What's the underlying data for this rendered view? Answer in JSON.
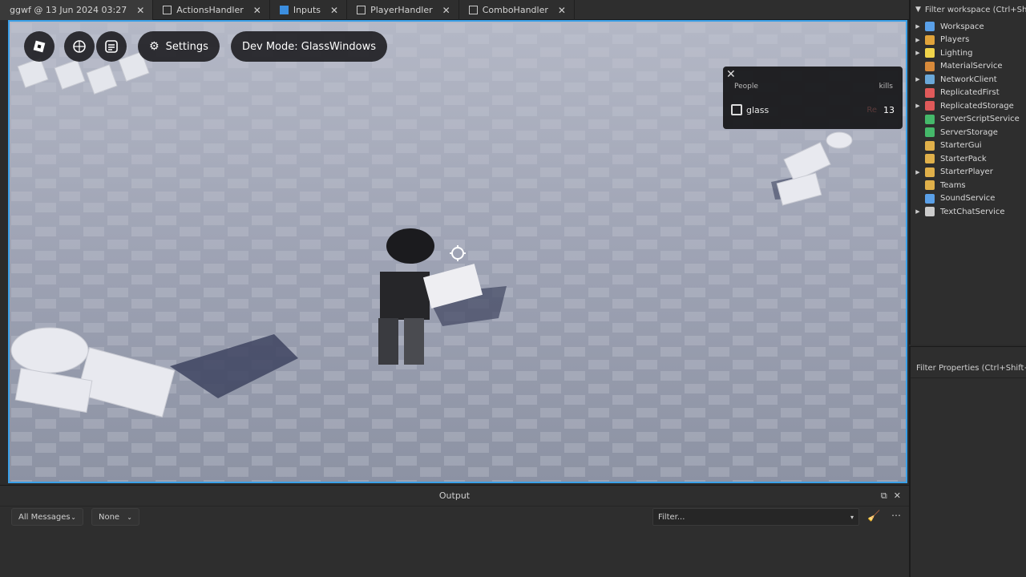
{
  "tabs": [
    {
      "label": "ggwf @ 13 Jun 2024 03:27",
      "icon": "place-icon",
      "color": ""
    },
    {
      "label": "ActionsHandler",
      "icon": "script-icon",
      "color": "#c9c9c9"
    },
    {
      "label": "Inputs",
      "icon": "module-script-icon",
      "color": "#3b8ee0"
    },
    {
      "label": "PlayerHandler",
      "icon": "script-icon",
      "color": "#c9c9c9"
    },
    {
      "label": "ComboHandler",
      "icon": "script-icon",
      "color": "#c9c9c9"
    }
  ],
  "game_ui": {
    "settings_label": "Settings",
    "dev_mode_label": "Dev Mode: GlassWindows",
    "leaderboard": {
      "col_people": "People",
      "col_kills": "kills",
      "rows": [
        {
          "name": "glass",
          "ghost": "Re",
          "kills": "13"
        }
      ]
    }
  },
  "explorer": {
    "filter_placeholder": "Filter workspace (Ctrl+Shift+X)",
    "items": [
      {
        "label": "Workspace",
        "expandable": true,
        "color": "#5aa0e8"
      },
      {
        "label": "Players",
        "expandable": true,
        "color": "#e0a33a"
      },
      {
        "label": "Lighting",
        "expandable": true,
        "color": "#f0d34a"
      },
      {
        "label": "MaterialService",
        "expandable": false,
        "color": "#d88a3a"
      },
      {
        "label": "NetworkClient",
        "expandable": true,
        "color": "#6aa8d8"
      },
      {
        "label": "ReplicatedFirst",
        "expandable": false,
        "color": "#e05a5a"
      },
      {
        "label": "ReplicatedStorage",
        "expandable": true,
        "color": "#e05a5a"
      },
      {
        "label": "ServerScriptService",
        "expandable": false,
        "color": "#45b86a"
      },
      {
        "label": "ServerStorage",
        "expandable": false,
        "color": "#45b86a"
      },
      {
        "label": "StarterGui",
        "expandable": false,
        "color": "#e0b04a"
      },
      {
        "label": "StarterPack",
        "expandable": false,
        "color": "#e0b04a"
      },
      {
        "label": "StarterPlayer",
        "expandable": true,
        "color": "#e0b04a"
      },
      {
        "label": "Teams",
        "expandable": false,
        "color": "#e0b04a"
      },
      {
        "label": "SoundService",
        "expandable": false,
        "color": "#5aa0e8"
      },
      {
        "label": "TextChatService",
        "expandable": true,
        "color": "#cccccc"
      }
    ]
  },
  "properties": {
    "filter_placeholder": "Filter Properties (Ctrl+Shift+P)"
  },
  "output": {
    "title": "Output",
    "messages_filter": "All Messages",
    "context_filter": "None",
    "filter_placeholder": "Filter..."
  }
}
